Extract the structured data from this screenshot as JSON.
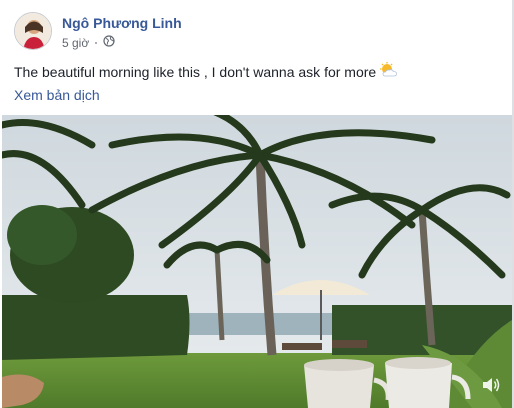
{
  "post": {
    "author_name": "Ngô Phương Linh",
    "timestamp": "5 giờ",
    "privacy_icon": "globe-icon",
    "text": "The beautiful morning like this , I don't wanna ask for more",
    "emoji_icon": "sun-behind-cloud-icon",
    "translate_label": "Xem bản dịch"
  },
  "video": {
    "volume_icon": "speaker-icon"
  },
  "colors": {
    "link": "#385898",
    "text": "#1d2129",
    "meta": "#616770"
  }
}
